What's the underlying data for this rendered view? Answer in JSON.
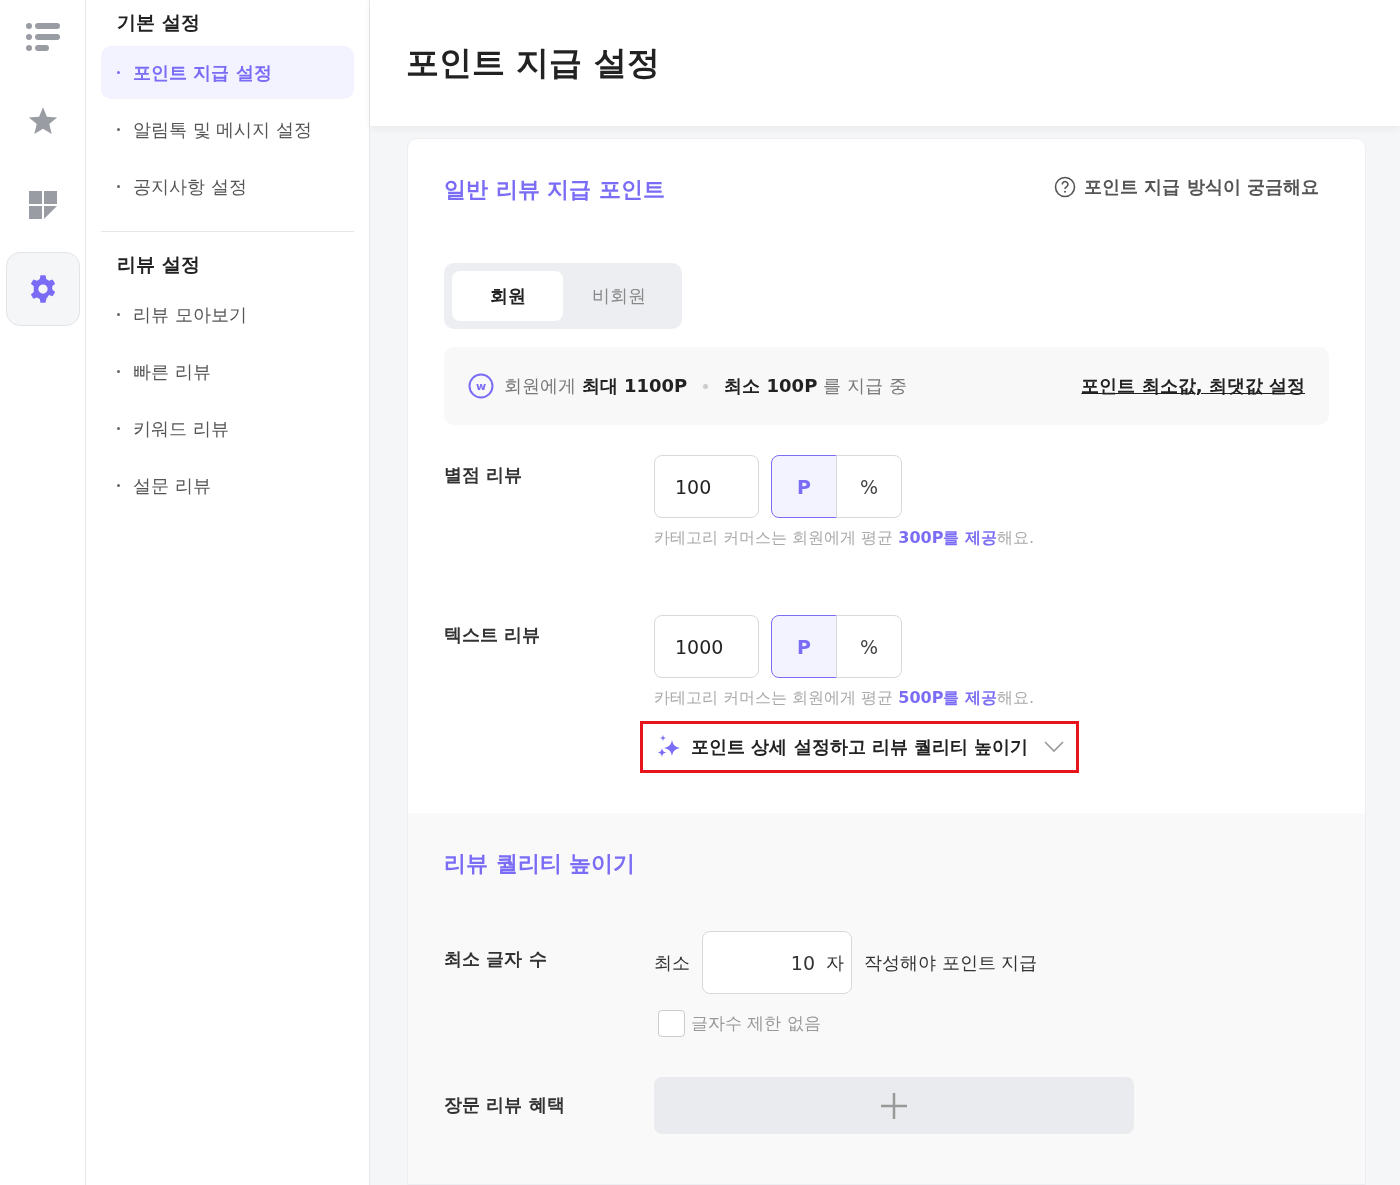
{
  "rail": [
    {
      "kind": "list",
      "selected": false
    },
    {
      "kind": "star",
      "selected": false
    },
    {
      "kind": "dashboard",
      "selected": false
    },
    {
      "kind": "settings",
      "selected": true
    }
  ],
  "sidebar": [
    {
      "title": "기본 설정",
      "items": [
        {
          "label": "포인트 지급 설정",
          "selected": true
        },
        {
          "label": "알림톡 및 메시지 설정",
          "selected": false
        },
        {
          "label": "공지사항 설정",
          "selected": false
        }
      ]
    },
    {
      "title": "리뷰 설정",
      "items": [
        {
          "label": "리뷰 모아보기",
          "selected": false
        },
        {
          "label": "빠른 리뷰",
          "selected": false
        },
        {
          "label": "키워드 리뷰",
          "selected": false
        },
        {
          "label": "설문 리뷰",
          "selected": false
        }
      ]
    }
  ],
  "page_title": "포인트 지급 설정",
  "card": {
    "title": "일반 리뷰 지급 포인트",
    "help_link": "포인트 지급 방식이 궁금해요",
    "tabs": [
      {
        "label": "회원",
        "selected": true
      },
      {
        "label": "비회원",
        "selected": false
      }
    ],
    "summary": {
      "badge": "w",
      "parts": [
        "회원에게 **최대 1100P**",
        "**최소 100P** 를 지급 중"
      ],
      "link": "포인트 최소값, 최댓값 설정"
    },
    "rows": [
      {
        "label": "별점 리뷰",
        "value": "100",
        "units": [
          {
            "label": "P",
            "selected": true
          },
          {
            "label": "%",
            "selected": false
          }
        ],
        "hint": "카테고리 커머스는 회원에게 평균 **300P를 제공**해요."
      },
      {
        "label": "텍스트 리뷰",
        "value": "1000",
        "units": [
          {
            "label": "P",
            "selected": true
          },
          {
            "label": "%",
            "selected": false
          }
        ],
        "hint": "카테고리 커머스는 회원에게 평균 **500P를 제공**해요."
      }
    ],
    "expand_button": {
      "label": "포인트 상세 설정하고 리뷰 퀄리티 높이기",
      "highlighted": true,
      "expanded": false
    }
  },
  "quality": {
    "title": "리뷰 퀄리티 높이기",
    "min_chars": {
      "label": "최소 글자 수",
      "prefix": "최소",
      "value": "10",
      "unit": "자",
      "suffix": "작성해야 포인트 지급"
    },
    "no_limit": {
      "label": "글자수 제한 없음",
      "checked": false
    },
    "long_review": {
      "label": "장문 리뷰 혜택"
    }
  }
}
